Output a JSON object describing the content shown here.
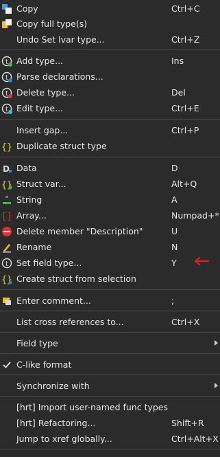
{
  "menu": {
    "items": [
      {
        "label": "Copy",
        "shortcut": "Ctrl+C",
        "icon": "copy-icon"
      },
      {
        "label": "Copy full type(s)",
        "shortcut": "",
        "icon": "copy-full-type-icon"
      },
      {
        "label": "Undo Set lvar type...",
        "shortcut": "Ctrl+Z",
        "icon": ""
      },
      {
        "label": "Add type...",
        "shortcut": "Ins",
        "icon": "add-type-icon"
      },
      {
        "label": "Parse declarations...",
        "shortcut": "",
        "icon": "parse-declarations-icon"
      },
      {
        "label": "Delete type...",
        "shortcut": "Del",
        "icon": "delete-type-icon"
      },
      {
        "label": "Edit type...",
        "shortcut": "Ctrl+E",
        "icon": "edit-type-icon"
      },
      {
        "label": "Insert gap...",
        "shortcut": "Ctrl+P",
        "icon": ""
      },
      {
        "label": "Duplicate struct type",
        "shortcut": "",
        "icon": "duplicate-struct-icon"
      },
      {
        "label": "Data",
        "shortcut": "D",
        "icon": "data-icon"
      },
      {
        "label": "Struct var...",
        "shortcut": "Alt+Q",
        "icon": "struct-var-icon"
      },
      {
        "label": "String",
        "shortcut": "A",
        "icon": "string-icon"
      },
      {
        "label": "Array...",
        "shortcut": "Numpad+*",
        "icon": "array-icon"
      },
      {
        "label": "Delete member \"Description\"",
        "shortcut": "U",
        "icon": "delete-member-icon"
      },
      {
        "label": "Rename",
        "shortcut": "N",
        "icon": "rename-icon"
      },
      {
        "label": "Set field type...",
        "shortcut": "Y",
        "icon": "set-field-type-icon"
      },
      {
        "label": "Create struct from selection",
        "shortcut": "",
        "icon": "create-struct-icon"
      },
      {
        "label": "Enter comment...",
        "shortcut": ";",
        "icon": "comment-icon"
      },
      {
        "label": "List cross references to...",
        "shortcut": "Ctrl+X",
        "icon": ""
      },
      {
        "label": "Field type",
        "shortcut": "",
        "icon": "",
        "submenu": true
      },
      {
        "label": "C-like format",
        "shortcut": "",
        "icon": "checkmark-icon"
      },
      {
        "label": "Synchronize with",
        "shortcut": "",
        "icon": "",
        "submenu": true
      },
      {
        "label": "[hrt] Import user-named func types",
        "shortcut": "",
        "icon": ""
      },
      {
        "label": "[hrt] Refactoring...",
        "shortcut": "Shift+R",
        "icon": ""
      },
      {
        "label": "Jump to xref globally...",
        "shortcut": "Ctrl+Alt+X",
        "icon": ""
      }
    ]
  },
  "colors": {
    "background": "#2b2b2b",
    "text": "#e6e6e6",
    "separator": "#4a4a4a",
    "annotation_arrow": "#e02020"
  }
}
